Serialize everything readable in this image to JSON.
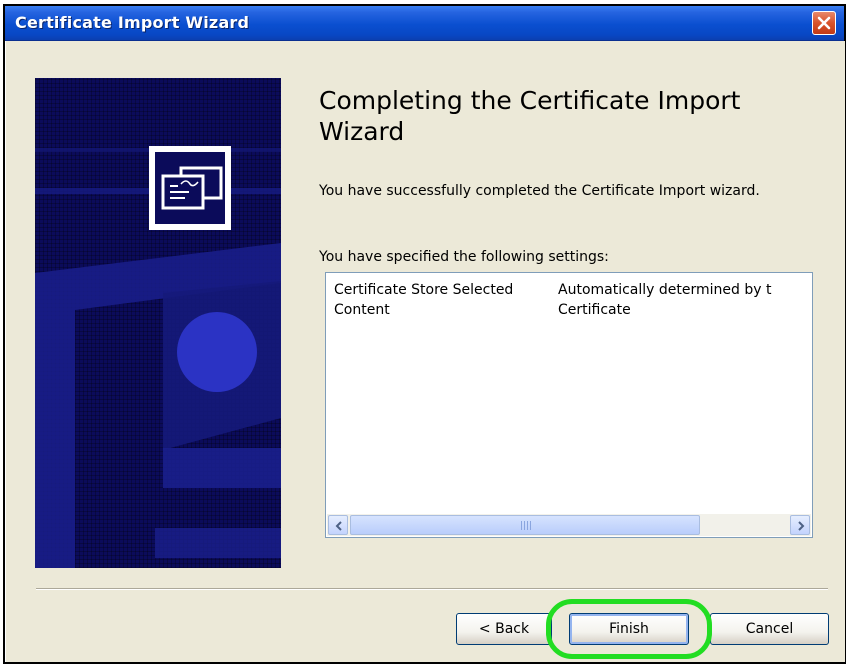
{
  "window": {
    "title": "Certificate Import Wizard",
    "close_icon": "close-icon"
  },
  "main": {
    "heading": "Completing the Certificate Import Wizard",
    "description": "You have successfully completed the Certificate Import wizard.",
    "settings_label": "You have specified the following settings:",
    "settings": [
      {
        "name": "Certificate Store Selected",
        "value": "Automatically determined by t"
      },
      {
        "name": "Content",
        "value": "Certificate"
      }
    ]
  },
  "buttons": {
    "back": "< Back",
    "finish": "Finish",
    "cancel": "Cancel"
  },
  "colors": {
    "titlebar": "#0a4fd0",
    "side_art": "#0b0b5a",
    "highlight": "#22dd22"
  }
}
